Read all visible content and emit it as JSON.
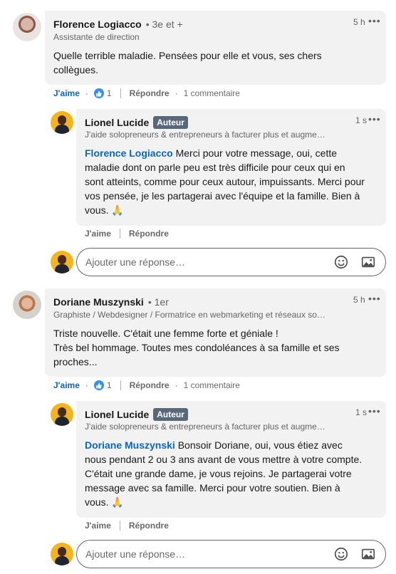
{
  "thread1": {
    "comment": {
      "name": "Florence Logiacco",
      "degree": "• 3e et +",
      "headline": "Assistante de direction",
      "time": "5 h",
      "text": "Quelle terrible maladie. Pensées pour elle et vous, ses chers collègues.",
      "like_label": "J'aime",
      "like_count": "1",
      "reply_label": "Répondre",
      "comments_count": "1 commentaire"
    },
    "reply": {
      "name": "Lionel Lucide",
      "badge": "Auteur",
      "headline": "J'aide solopreneurs & entrepreneurs à facturer plus et augme…",
      "time": "1 s",
      "mention": "Florence Logiacco",
      "text": " Merci pour votre message, oui, cette maladie dont on parle peu est très difficile pour ceux qui en sont atteints, comme pour ceux autour, impuissants. Merci pour vos pensée, je les partagerai avec l'équipe et la famille. Bien à vous. 🙏",
      "like_label": "J'aime",
      "reply_label": "Répondre"
    },
    "reply_box": {
      "placeholder": "Ajouter une réponse…"
    }
  },
  "thread2": {
    "comment": {
      "name": "Doriane Muszynski",
      "degree": "• 1er",
      "headline": "Graphiste / Webdesigner / Formatrice en webmarketing et réseaux so…",
      "time": "5 h",
      "text_line1": "Triste nouvelle. C'était une femme forte et géniale !",
      "text_line2": "Très bel hommage. Toutes mes condoléances à sa famille et ses proches...",
      "like_label": "J'aime",
      "like_count": "1",
      "reply_label": "Répondre",
      "comments_count": "1 commentaire"
    },
    "reply": {
      "name": "Lionel Lucide",
      "badge": "Auteur",
      "headline": "J'aide solopreneurs & entrepreneurs à facturer plus et augme…",
      "time": "1 s",
      "mention": "Doriane Muszynski",
      "text": " Bonsoir Doriane, oui, vous étiez avec nous pendant 2 ou 3 ans avant de vous mettre à votre compte. C'était une grande dame, je vous rejoins. Je partagerai votre message avec sa famille. Merci pour votre soutien. Bien à vous. 🙏",
      "like_label": "J'aime",
      "reply_label": "Répondre"
    },
    "reply_box": {
      "placeholder": "Ajouter une réponse…"
    }
  },
  "icons": {
    "more": "more-icon",
    "like": "thumbs-up-icon",
    "emoji": "emoji-icon",
    "image": "image-icon"
  },
  "colors": {
    "link": "#0a66c2",
    "bubble": "#f2f2f2",
    "badge": "#56687a",
    "like_icon": "#378fe9"
  }
}
